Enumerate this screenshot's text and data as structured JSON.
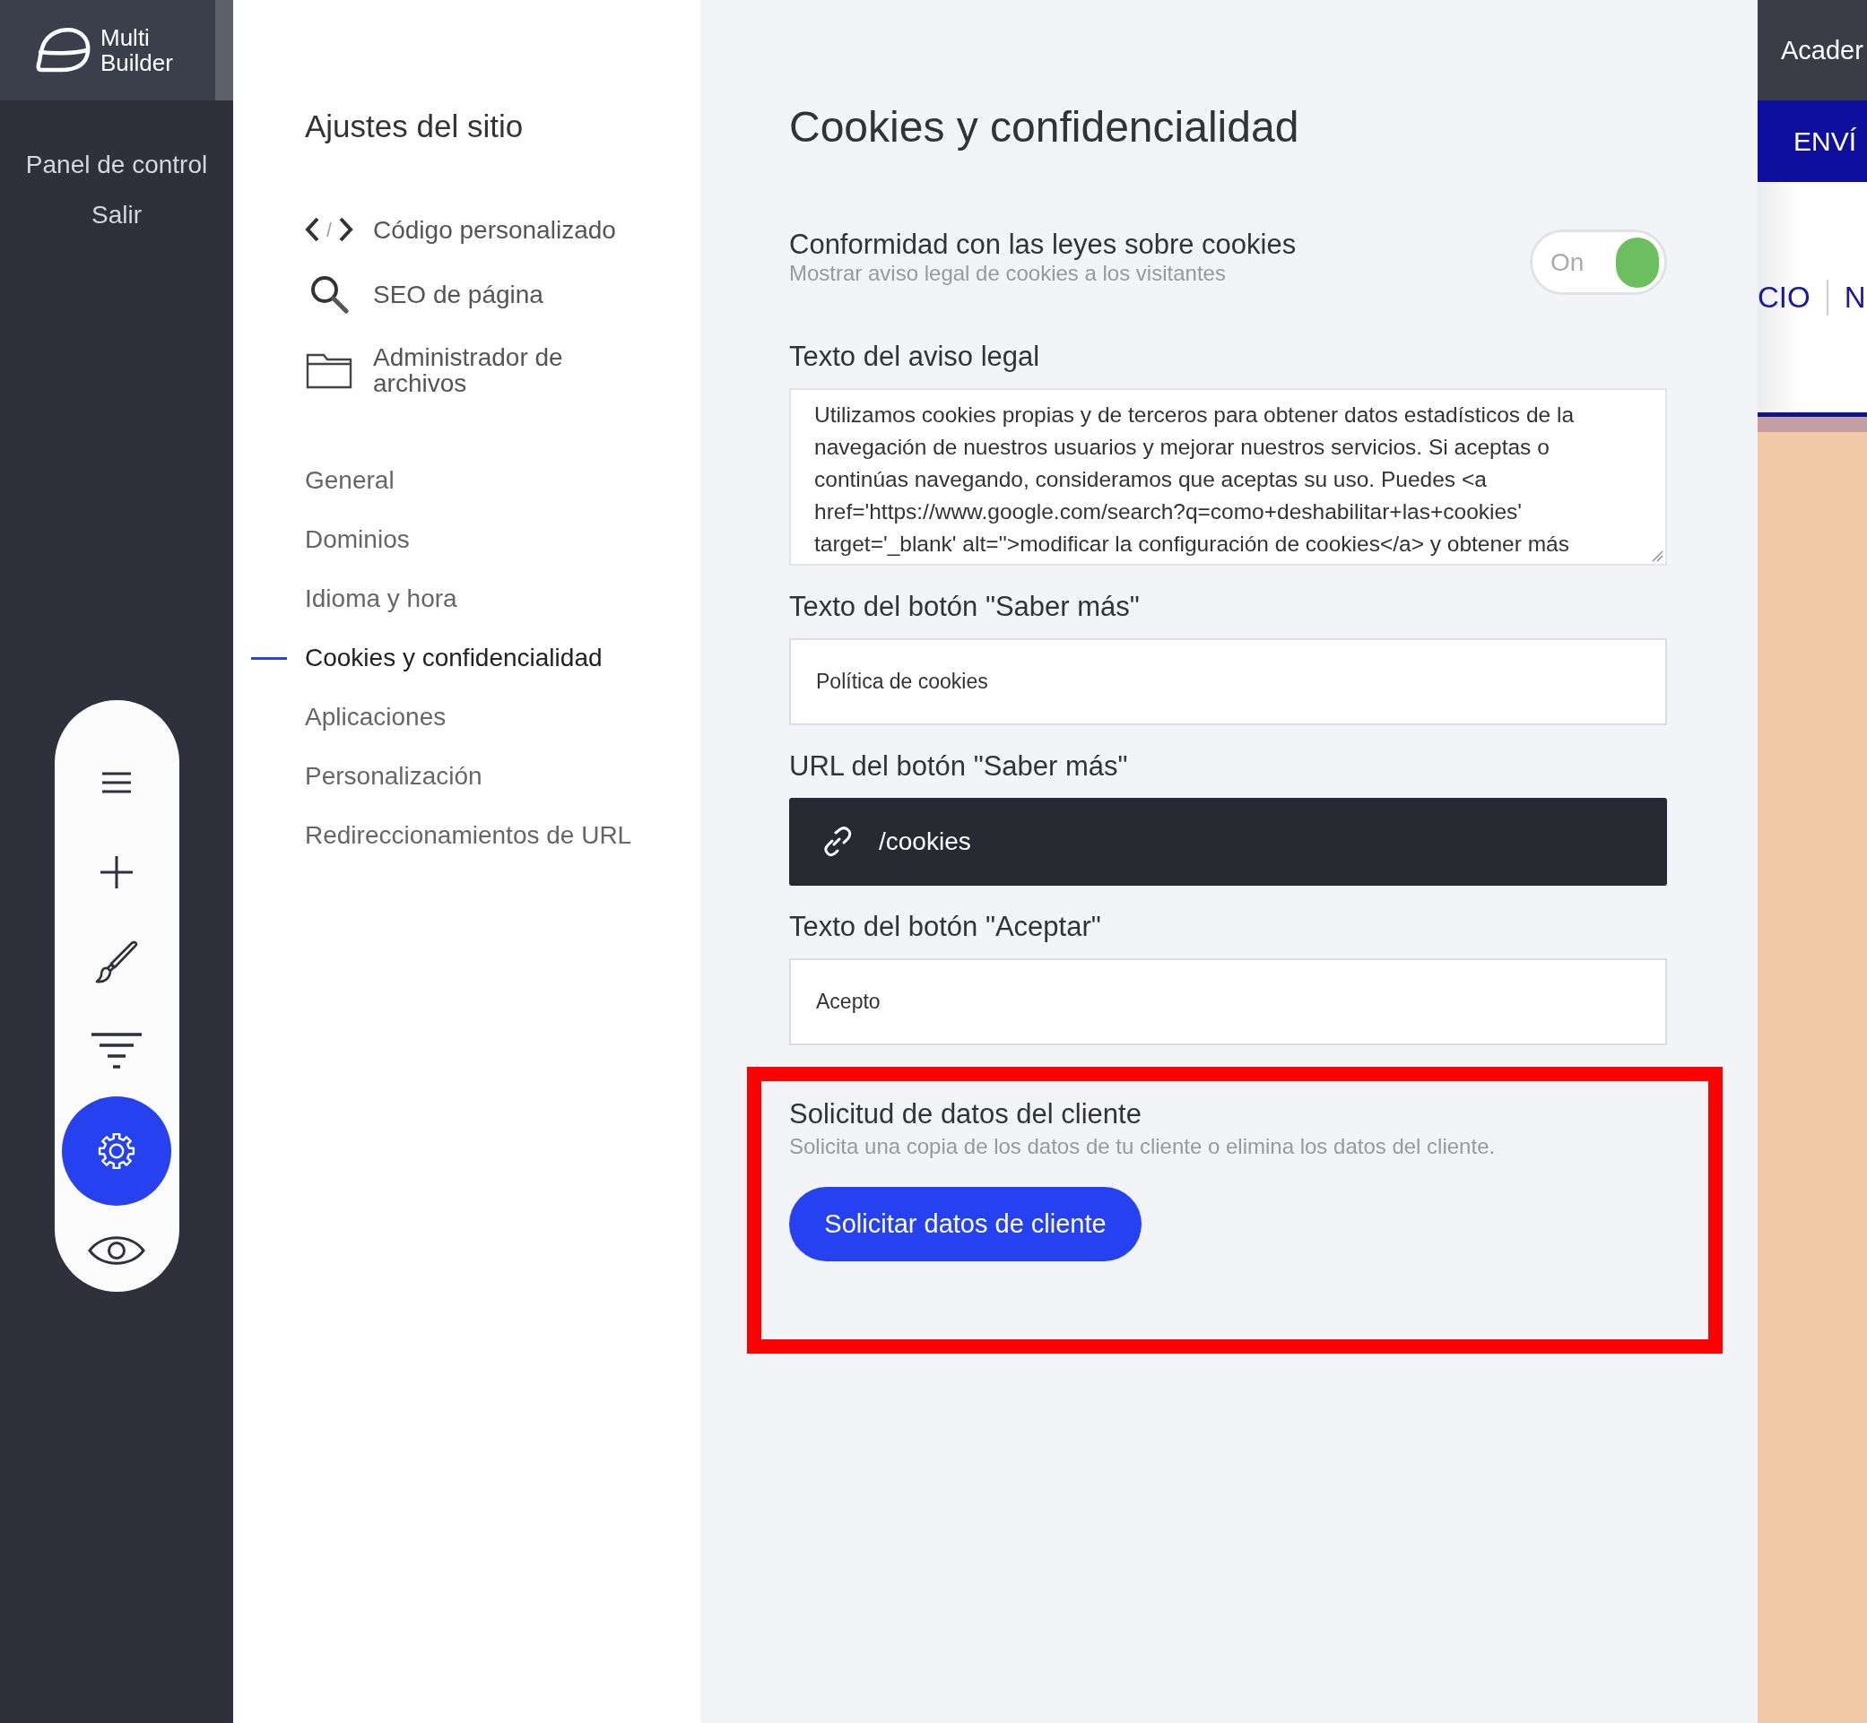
{
  "brand": {
    "line1": "Multi",
    "line2": "Builder"
  },
  "nav_links": [
    "Panel de control",
    "Salir"
  ],
  "toolbar": [
    {
      "kind": "menu",
      "selected": false
    },
    {
      "kind": "add",
      "selected": false
    },
    {
      "kind": "brush",
      "selected": false
    },
    {
      "kind": "filter",
      "selected": false
    },
    {
      "kind": "settings",
      "selected": true
    },
    {
      "kind": "preview",
      "selected": false
    }
  ],
  "settings_panel": {
    "title": "Ajustes del sitio",
    "tools": [
      {
        "kind": "code",
        "label": "Código personalizado"
      },
      {
        "kind": "search",
        "label": "SEO de página"
      },
      {
        "kind": "folder",
        "label": "Administrador de archivos"
      }
    ],
    "sections": [
      {
        "label": "General",
        "selected": false
      },
      {
        "label": "Dominios",
        "selected": false
      },
      {
        "label": "Idioma y hora",
        "selected": false
      },
      {
        "label": "Cookies y confidencialidad",
        "selected": true
      },
      {
        "label": "Aplicaciones",
        "selected": false
      },
      {
        "label": "Personalización",
        "selected": false
      },
      {
        "label": "Redireccionamientos de URL",
        "selected": false
      }
    ]
  },
  "main": {
    "title": "Cookies y confidencialidad",
    "compliance": {
      "title": "Conformidad con las leyes sobre cookies",
      "subtitle": "Mostrar aviso legal de cookies a los visitantes",
      "toggle_label": "On",
      "on": true
    },
    "fields": [
      {
        "kind": "textarea",
        "label": "Texto del aviso legal",
        "value": "Utilizamos cookies propias y de terceros para obtener datos estadísticos de la navegación de nuestros usuarios y mejorar nuestros servicios. Si aceptas o continúas navegando, consideramos que aceptas su uso. Puedes <a href='https://www.google.com/search?q=como+deshabilitar+las+cookies' target='_blank' alt=''>modificar la configuración de cookies</a> y obtener más"
      },
      {
        "kind": "text",
        "label": "Texto del botón \"Saber más\"",
        "value": "Política de cookies"
      },
      {
        "kind": "url",
        "label": "URL del botón \"Saber más\"",
        "value": "/cookies"
      },
      {
        "kind": "text",
        "label": "Texto del botón \"Aceptar\"",
        "value": "Acepto"
      }
    ],
    "customer_data": {
      "title": "Solicitud de datos del cliente",
      "subtitle": "Solicita una copia de los datos de tu cliente o elimina los datos del cliente.",
      "button": "Solicitar datos de cliente"
    }
  },
  "preview": {
    "top_text": "Acader",
    "banner_text": "ENVÍ",
    "menu_items": [
      "CIO",
      "N"
    ]
  }
}
